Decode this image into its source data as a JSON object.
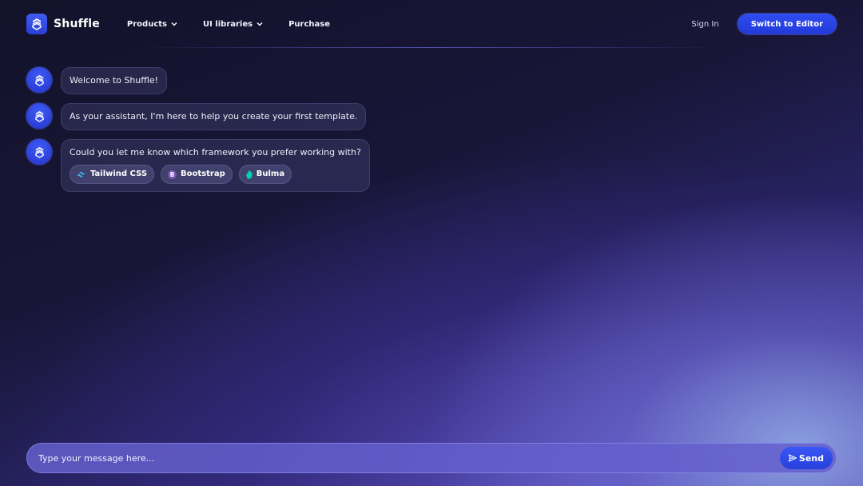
{
  "brand": {
    "name": "Shuffle",
    "icon": "shuffle-logo-icon"
  },
  "nav": {
    "items": [
      {
        "label": "Products",
        "has_dropdown": true
      },
      {
        "label": "UI libraries",
        "has_dropdown": true
      },
      {
        "label": "Purchase",
        "has_dropdown": false
      }
    ]
  },
  "header": {
    "signin_label": "Sign In",
    "editor_button_label": "Switch to Editor"
  },
  "chat": {
    "messages": [
      {
        "text": "Welcome to Shuffle!"
      },
      {
        "text": "As your assistant, I'm here to help you create your first template."
      },
      {
        "text": "Could you let me know which framework you prefer working with?"
      }
    ],
    "options": [
      {
        "label": "Tailwind CSS",
        "icon": "tailwind-icon",
        "color": "#38bdf8"
      },
      {
        "label": "Bootstrap",
        "icon": "bootstrap-icon",
        "color": "#7952b3"
      },
      {
        "label": "Bulma",
        "icon": "bulma-icon",
        "color": "#00d1b2"
      }
    ]
  },
  "composer": {
    "placeholder": "Type your message here...",
    "value": "",
    "send_label": "Send"
  },
  "colors": {
    "accent": "#2f4df2",
    "background": "#181638"
  }
}
